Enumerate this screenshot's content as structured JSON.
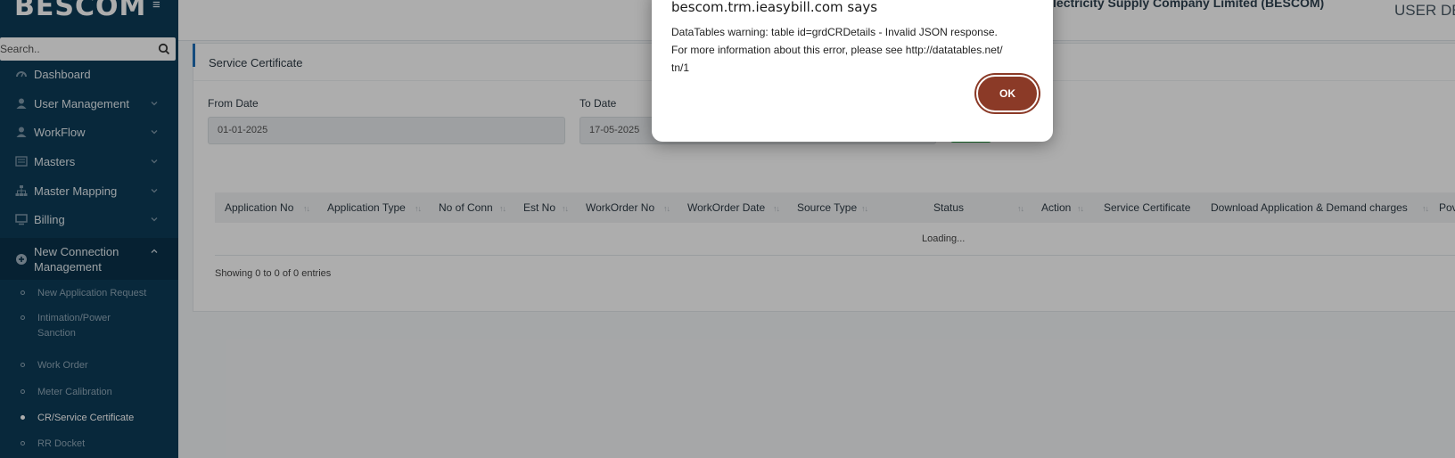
{
  "sidebar": {
    "brand": "BESCOM",
    "search_placeholder": "Search..",
    "items": [
      {
        "label": "Dashboard",
        "icon": "dashboard-icon"
      },
      {
        "label": "User Management",
        "icon": "user-icon"
      },
      {
        "label": "WorkFlow",
        "icon": "user-icon"
      },
      {
        "label": "Masters",
        "icon": "list-icon"
      },
      {
        "label": "Master Mapping",
        "icon": "sitemap-icon"
      },
      {
        "label": "Billing",
        "icon": "monitor-icon"
      },
      {
        "label": "New Connection Management",
        "label_line1": "New Connection",
        "label_line2": "Management",
        "icon": "plus-circle-icon"
      }
    ],
    "subitems": [
      {
        "label": "New Application Request"
      },
      {
        "label": "Intimation/Power Sanction",
        "label_line1": "Intimation/Power",
        "label_line2": "Sanction"
      },
      {
        "label": "Work Order"
      },
      {
        "label": "Meter Calibration"
      },
      {
        "label": "CR/Service Certificate"
      },
      {
        "label": "RR Docket"
      }
    ]
  },
  "header": {
    "company": "e Electricity Supply Company Limited (BESCOM)",
    "user": "USER DE"
  },
  "page": {
    "title": "Service Certificate",
    "from_date_label": "From Date",
    "from_date_value": "01-01-2025",
    "to_date_label": "To Date",
    "to_date_value": "17-05-2025"
  },
  "table": {
    "columns": [
      "Application No",
      "Application Type",
      "No of Conn",
      "Est No",
      "WorkOrder No",
      "WorkOrder Date",
      "Source Type",
      "Status",
      "Action",
      "Service Certificate",
      "Download Application & Demand charges",
      "Pov"
    ],
    "loading_text": "Loading...",
    "info_text": "Showing 0 to 0 of 0 entries"
  },
  "dialog": {
    "title": "bescom.trm.ieasybill.com says",
    "message_line1": "DataTables warning: table id=grdCRDetails - Invalid JSON response.",
    "message_line2": "For more information about this error, please see http://datatables.net/",
    "message_line3": "tn/1",
    "ok_label": "OK"
  },
  "colors": {
    "sidebar_bg": "#0d3b57",
    "accent_blue": "#1e6fb8",
    "ok_button": "#8b3a27",
    "search_button": "#28a745"
  }
}
